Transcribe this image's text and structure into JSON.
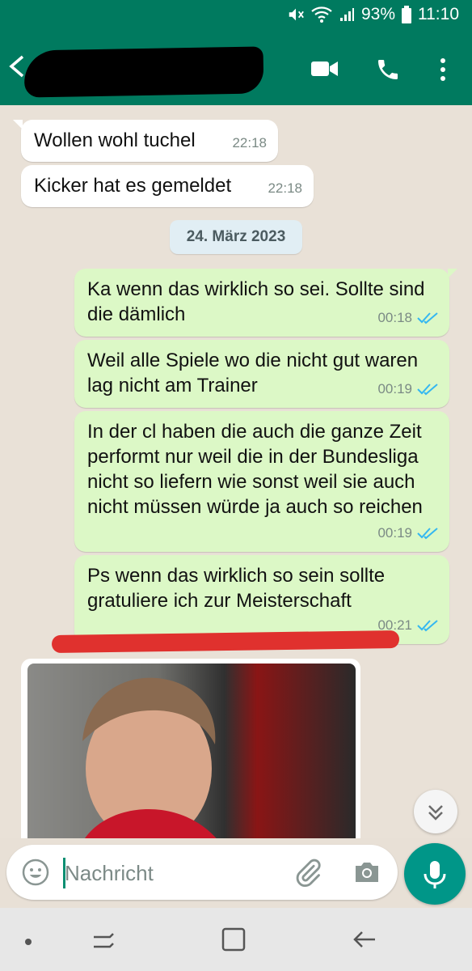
{
  "status_bar": {
    "battery": "93%",
    "time": "11:10"
  },
  "header": {
    "contact_name": ""
  },
  "messages": [
    {
      "direction": "in",
      "text": "Wollen wohl tuchel",
      "time": "22:18"
    },
    {
      "direction": "in",
      "text": "Kicker hat es gemeldet",
      "time": "22:18"
    },
    {
      "direction": "out",
      "text": "Ka wenn das wirklich so sei. Sollte sind die dämlich",
      "time": "00:18",
      "status": "read"
    },
    {
      "direction": "out",
      "text": "Weil alle Spiele wo die nicht gut waren lag nicht am Trainer",
      "time": "00:19",
      "status": "read"
    },
    {
      "direction": "out",
      "text": "In der cl haben die auch die ganze Zeit performt nur weil die in der Bundesliga nicht so liefern wie sonst weil sie auch nicht müssen würde ja auch so reichen",
      "time": "00:19",
      "status": "read"
    },
    {
      "direction": "out",
      "text": "Ps wenn das wirklich so sein sollte gratuliere ich zur Meisterschaft",
      "time": "00:21",
      "status": "read"
    }
  ],
  "date_separator": "24. März 2023",
  "composer": {
    "placeholder": "Nachricht"
  },
  "colors": {
    "header": "#007a5f",
    "outgoing_bubble": "#dcf8c6",
    "incoming_bubble": "#ffffff",
    "read_ticks": "#34b7f1",
    "mic_button": "#009688",
    "redaction_line": "#e0312e"
  },
  "icons": [
    "mute-icon",
    "wifi-icon",
    "signal-icon",
    "battery-icon",
    "back-arrow-icon",
    "video-call-icon",
    "phone-icon",
    "more-options-icon",
    "double-check-icon",
    "scroll-down-icon",
    "emoji-icon",
    "attach-icon",
    "camera-icon",
    "mic-icon",
    "nav-dot-icon",
    "nav-recents-icon",
    "nav-home-icon",
    "nav-back-icon"
  ]
}
